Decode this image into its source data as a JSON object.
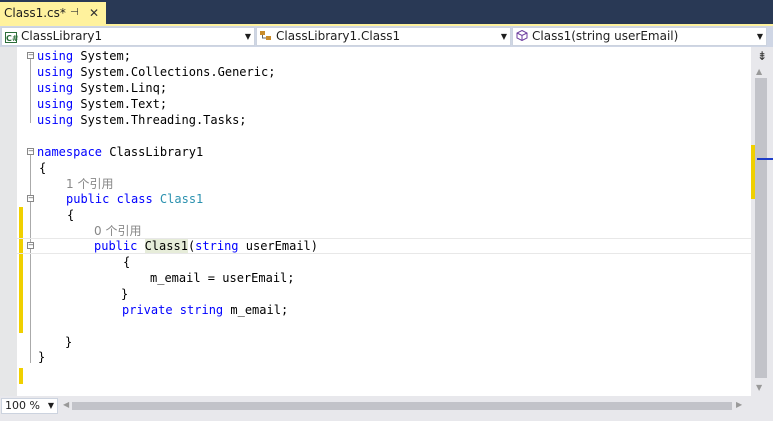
{
  "tab": {
    "title": "Class1.cs*",
    "pin_glyph": "⊣",
    "close_glyph": "✕"
  },
  "navbar": {
    "project": {
      "icon_text": "C#",
      "label": "ClassLibrary1"
    },
    "type": {
      "label": "ClassLibrary1.Class1"
    },
    "member": {
      "label": "Class1(string userEmail)"
    },
    "arrow_glyph": "▼"
  },
  "code": {
    "usings": [
      {
        "kw": "using",
        "ns": " System;"
      },
      {
        "kw": "using",
        "ns": " System.Collections.Generic;"
      },
      {
        "kw": "using",
        "ns": " System.Linq;"
      },
      {
        "kw": "using",
        "ns": " System.Text;"
      },
      {
        "kw": "using",
        "ns": " System.Threading.Tasks;"
      }
    ],
    "namespace_kw": "namespace",
    "namespace_name": " ClassLibrary1",
    "open_brace": "{",
    "close_brace": "}",
    "class_refs": "1 个引用",
    "class_mods": "public class ",
    "class_name": "Class1",
    "ctor_refs": "0 个引用",
    "ctor_kw": "public ",
    "ctor_name": "Class1",
    "ctor_paren": "(",
    "ctor_param_kw": "string",
    "ctor_param": " userEmail)",
    "assign": "m_email = userEmail;",
    "field_kw": "private string",
    "field_name": " m_email;"
  },
  "scrollbar": {
    "split_glyph": "⇟",
    "up_glyph": "▲",
    "down_glyph": "▼",
    "left_glyph": "◀",
    "right_glyph": "▶"
  },
  "zoom": {
    "value": "100 %"
  }
}
